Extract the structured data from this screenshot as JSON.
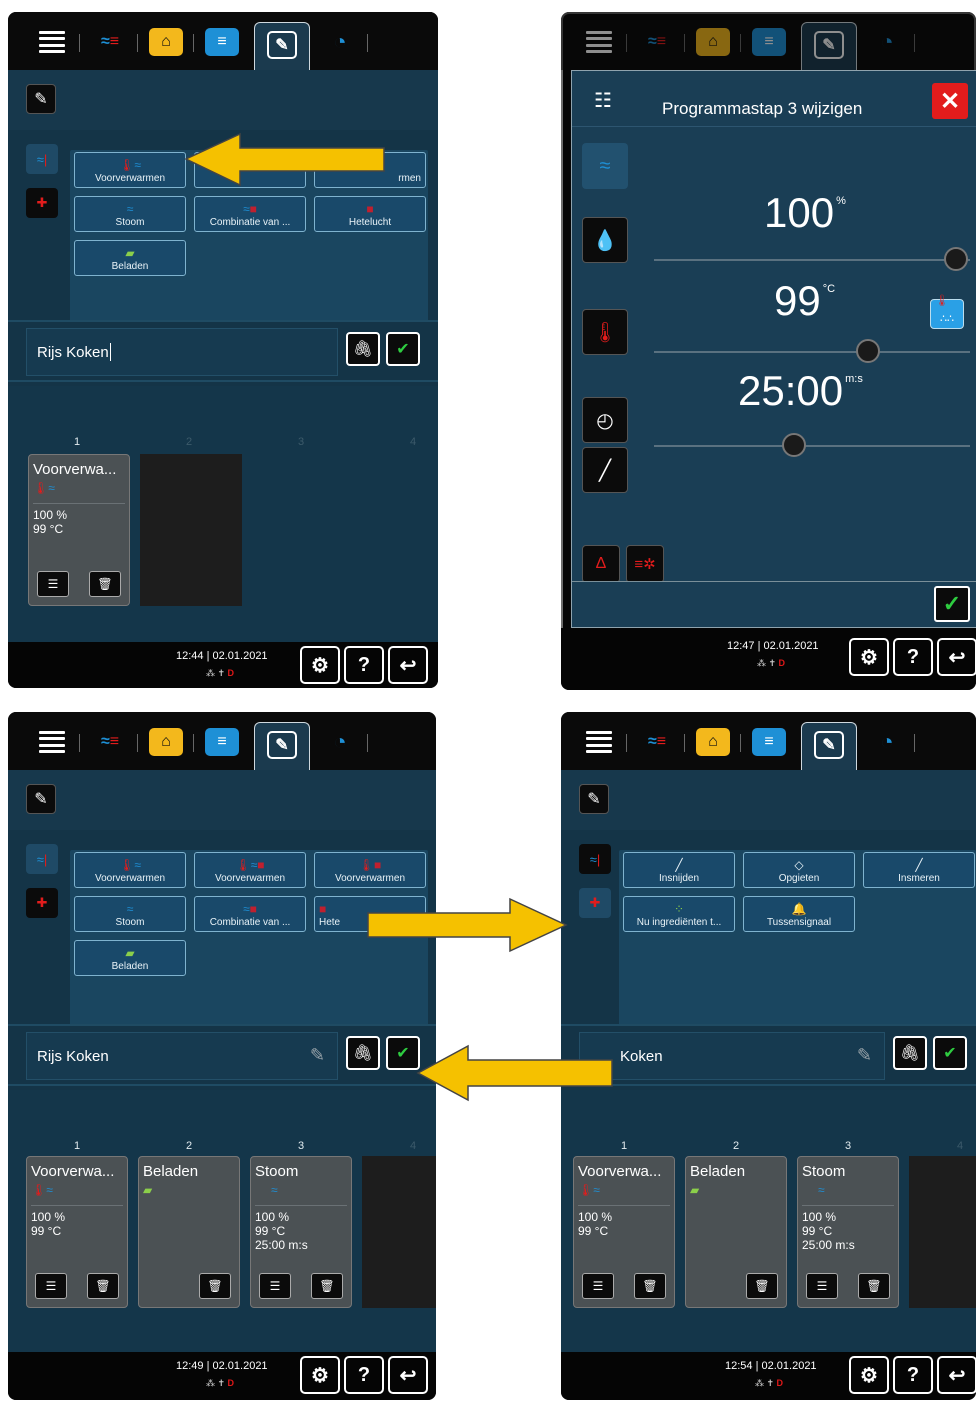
{
  "tabs": {
    "icons": [
      "menu-icon",
      "cooking-modes-icon",
      "ipc-icon",
      "icooking-icon",
      "programming-icon",
      "icare-icon"
    ]
  },
  "panel_tl": {
    "categories": {
      "cooking": "cooking-category-icon",
      "extras": "extras-category-icon"
    },
    "buttons": [
      "Voorverwarmen",
      "",
      "rmen",
      "Stoom",
      "Combinatie van ...",
      "Hetelucht",
      "Beladen"
    ],
    "name_value": "Rijs Koken",
    "steps": [
      {
        "num": "1",
        "title": "Voorverwa...",
        "v1": "100 %",
        "v2": "99 °C",
        "v3": ""
      }
    ],
    "empty_num_2": "2",
    "empty_num_3": "3",
    "empty_num_4": "4",
    "clock": "12:44  |  02.01.2021"
  },
  "panel_tr": {
    "title": "Programmastap 3 wijzigen",
    "humidity": {
      "value": "100",
      "unit": "%"
    },
    "temperature": {
      "value": "99",
      "unit": "°C"
    },
    "time": {
      "value": "25:00",
      "unit": "m:s"
    },
    "clock": "12:47  |  02.01.2021"
  },
  "panel_bl": {
    "buttons": [
      "Voorverwarmen",
      "Voorverwarmen",
      "Voorverwarmen",
      "Stoom",
      "Combinatie van ...",
      "Hete",
      "Beladen"
    ],
    "name_value": "Rijs Koken",
    "steps": [
      {
        "num": "1",
        "title": "Voorverwa...",
        "v1": "100 %",
        "v2": "99 °C",
        "v3": ""
      },
      {
        "num": "2",
        "title": "Beladen",
        "v1": "",
        "v2": "",
        "v3": ""
      },
      {
        "num": "3",
        "title": "Stoom",
        "v1": "100 %",
        "v2": "99 °C",
        "v3": "25:00 m:s"
      }
    ],
    "empty_num": "4",
    "clock": "12:49  |  02.01.2021"
  },
  "panel_br": {
    "buttons": [
      "Insnijden",
      "Opgieten",
      "Insmeren",
      "Nu ingrediënten t...",
      "Tussensignaal"
    ],
    "name_value": "Koken",
    "steps": [
      {
        "num": "1",
        "title": "Voorverwa...",
        "v1": "100 %",
        "v2": "99 °C",
        "v3": ""
      },
      {
        "num": "2",
        "title": "Beladen",
        "v1": "",
        "v2": "",
        "v3": ""
      },
      {
        "num": "3",
        "title": "Stoom",
        "v1": "100 %",
        "v2": "99 °C",
        "v3": "25:00 m:s"
      }
    ],
    "empty_num": "4",
    "clock": "12:54  |  02.01.2021"
  },
  "bottom": {
    "help": "?",
    "status_d": "D"
  },
  "colors": {
    "arrow": "#f5c100",
    "arrow_outline": "#3a3a3a",
    "accent_blue": "#1e90d6",
    "red": "#e21c1c",
    "green": "#2ecc40"
  }
}
